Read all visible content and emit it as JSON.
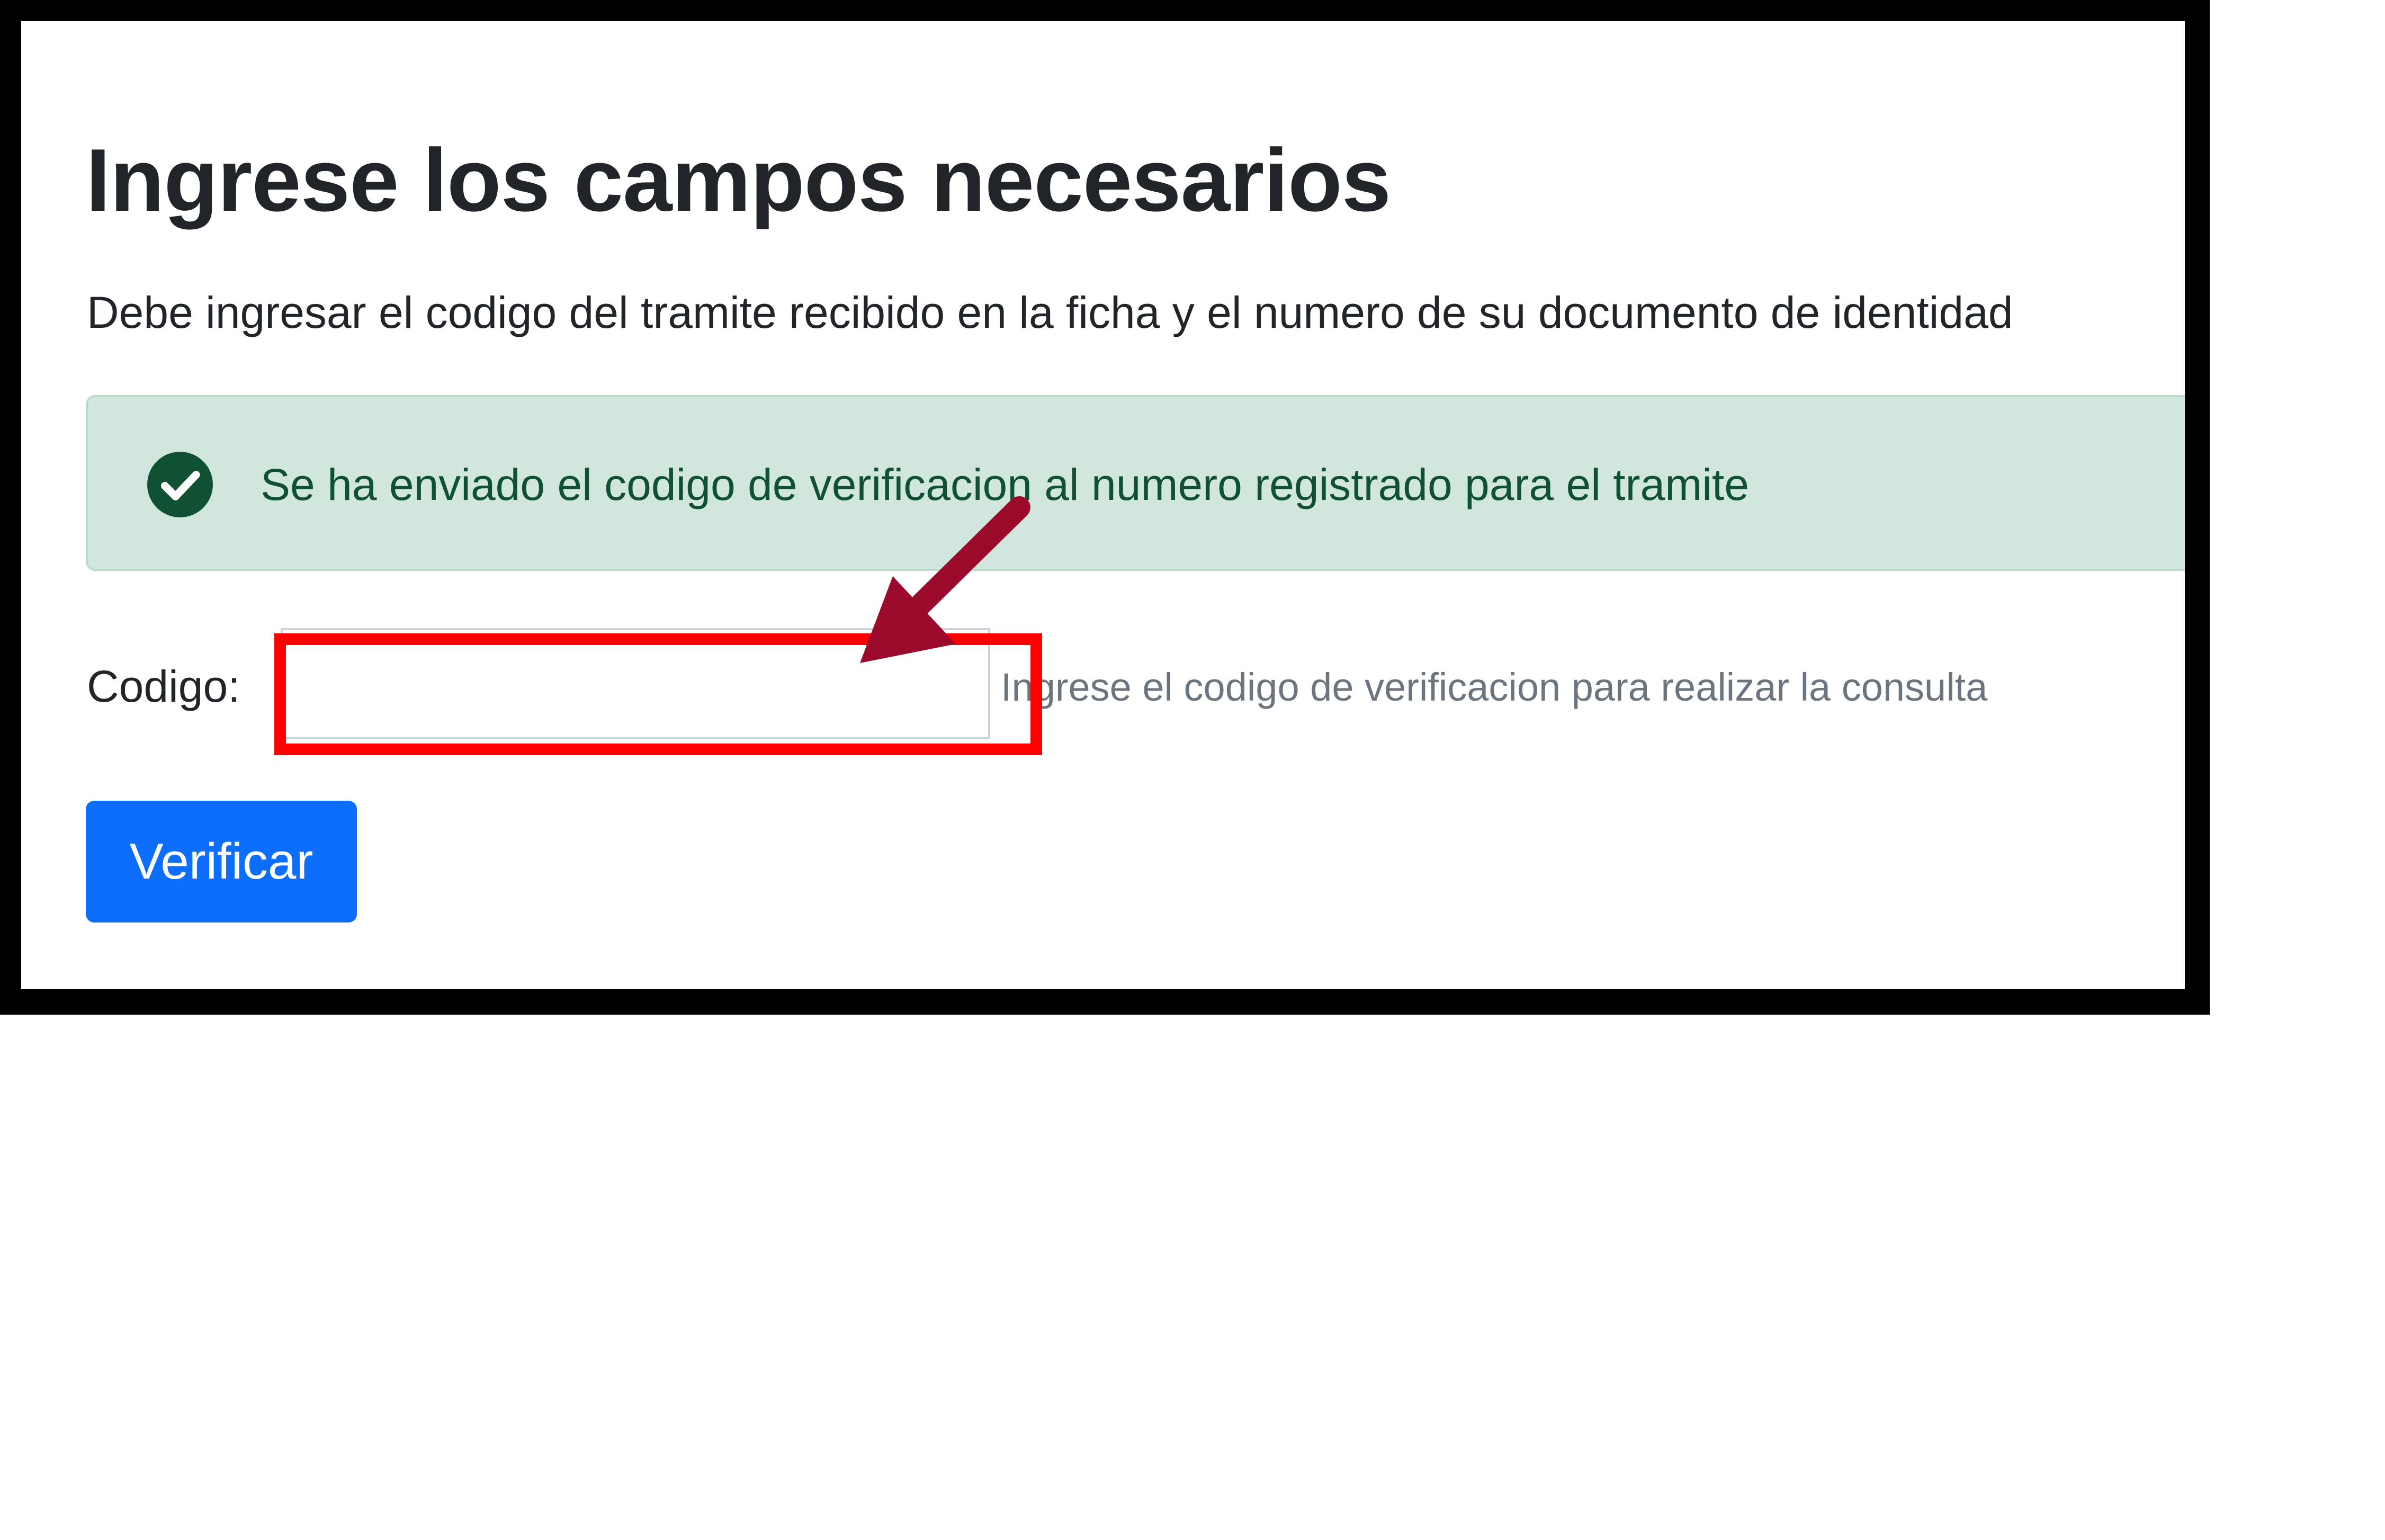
{
  "page": {
    "title": "Ingrese los campos necesarios",
    "subtitle": "Debe ingresar el codigo del tramite recibido en la ficha y el numero de su documento de identidad"
  },
  "alert": {
    "icon": "check-circle-icon",
    "message": "Se ha enviado el codigo de verificacion al numero registrado para el tramite",
    "colors": {
      "background": "#d1e7dd",
      "border": "#badbcc",
      "text": "#0f5132"
    }
  },
  "form": {
    "code_label": "Codigo:",
    "code_value": "",
    "code_placeholder": "",
    "help_text": "Ingrese el codigo de verificacion para realizar la consulta",
    "submit_label": "Verificar"
  },
  "annotation": {
    "highlight_color": "#ff0000",
    "arrow_color": "#9b0a2a",
    "arrow_icon": "arrow-down-left-icon"
  },
  "colors": {
    "primary": "#0d6efd",
    "text": "#212529",
    "muted": "#6c757d"
  }
}
